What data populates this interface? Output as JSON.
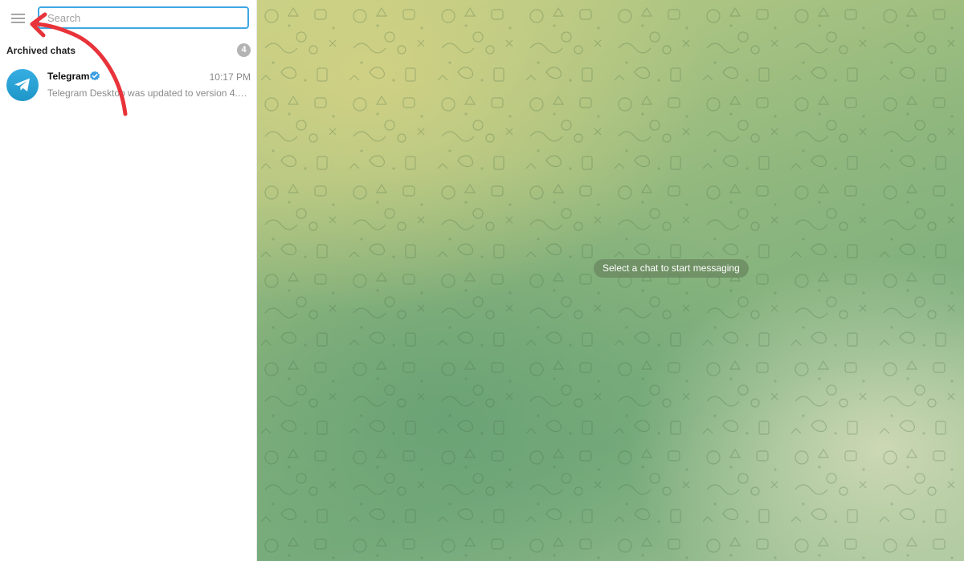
{
  "search": {
    "placeholder": "Search",
    "value": ""
  },
  "archived": {
    "label": "Archived chats",
    "count": "4"
  },
  "chats": [
    {
      "name": "Telegram",
      "verified": true,
      "time": "10:17 PM",
      "preview": "Telegram Desktop was updated to version 4.8..."
    }
  ],
  "main": {
    "empty_message": "Select a chat to start messaging"
  },
  "colors": {
    "accent": "#40a7e3",
    "annotation_arrow": "#e8333a",
    "pattern_bg": "#8fb77e"
  },
  "icons": {
    "menu": "hamburger-menu-icon",
    "avatar": "telegram-plane-icon",
    "verified": "verified-badge-icon"
  }
}
